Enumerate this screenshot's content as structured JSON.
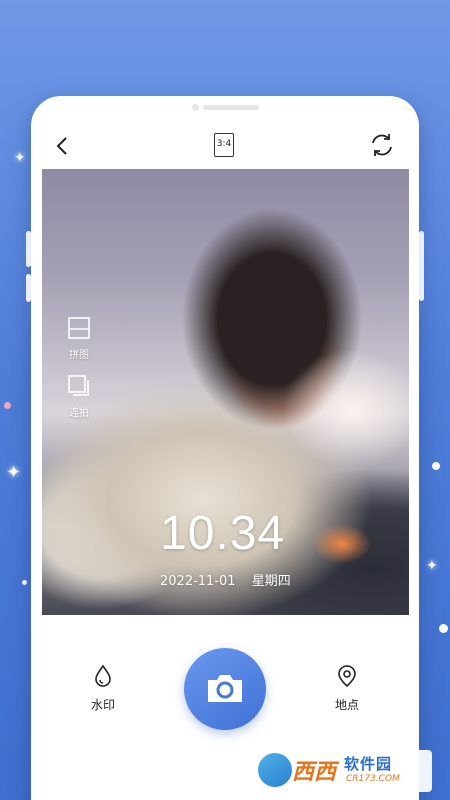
{
  "toolbar": {
    "back_icon": "chevron-left-icon",
    "aspect_ratio": "3:4",
    "switch_icon": "camera-switch-icon"
  },
  "side_tools": [
    {
      "icon": "collage-icon",
      "label": "拼图"
    },
    {
      "icon": "burst-icon",
      "label": "连拍"
    }
  ],
  "overlay": {
    "time": "10.34",
    "date": "2022-11-01",
    "weekday": "星期四"
  },
  "bottom_bar": {
    "watermark": {
      "icon": "droplet-icon",
      "label": "水印"
    },
    "shutter_icon": "camera-icon",
    "location": {
      "icon": "location-pin-icon",
      "label": "地点"
    }
  },
  "site_watermark": {
    "brand": "西西",
    "title": "软件园",
    "url": "CR173.COM"
  },
  "colors": {
    "accent": "#4f7fd9",
    "shutter": "#3f70d5"
  }
}
